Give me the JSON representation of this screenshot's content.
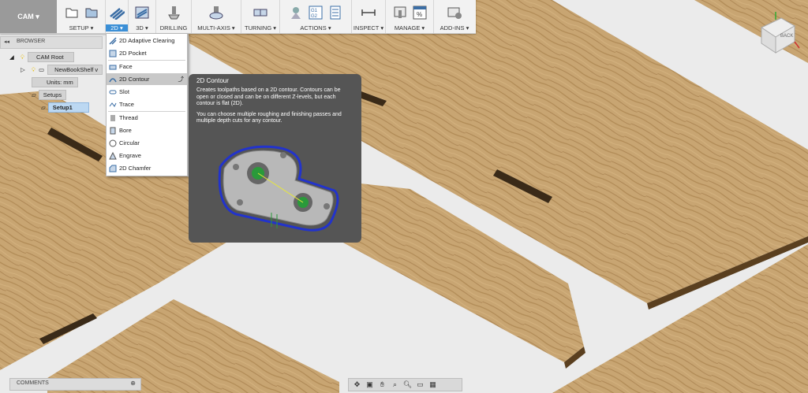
{
  "toolbar": {
    "workspace": "CAM",
    "groups": [
      {
        "label": "SETUP"
      },
      {
        "label": "2D"
      },
      {
        "label": "3D"
      },
      {
        "label": "DRILLING"
      },
      {
        "label": "MULTI-AXIS"
      },
      {
        "label": "TURNING"
      },
      {
        "label": "ACTIONS"
      },
      {
        "label": "INSPECT"
      },
      {
        "label": "MANAGE"
      },
      {
        "label": "ADD-INS"
      }
    ],
    "accent": "#3b8fd6"
  },
  "browser": {
    "title": "BROWSER",
    "root": "CAM Root",
    "model": "NewBookShelf v",
    "units_label": "Units:",
    "units_value": "mm",
    "setups": "Setups",
    "setup1": "Setup1"
  },
  "menu": {
    "items": [
      {
        "label": "2D Adaptive Clearing",
        "icon": "adaptive-clearing-icon"
      },
      {
        "label": "2D Pocket",
        "icon": "pocket-icon"
      },
      {
        "label": "Face",
        "icon": "face-icon"
      },
      {
        "label": "2D Contour",
        "icon": "contour-icon",
        "highlighted": true
      },
      {
        "label": "Slot",
        "icon": "slot-icon"
      },
      {
        "label": "Trace",
        "icon": "trace-icon"
      },
      {
        "label": "Thread",
        "icon": "thread-icon"
      },
      {
        "label": "Bore",
        "icon": "bore-icon"
      },
      {
        "label": "Circular",
        "icon": "circular-icon"
      },
      {
        "label": "Engrave",
        "icon": "engrave-icon"
      },
      {
        "label": "2D Chamfer",
        "icon": "chamfer-icon"
      }
    ]
  },
  "tooltip": {
    "title": "2D Contour",
    "p1": "Creates toolpaths based on a 2D contour. Contours can be open or closed and can be on different Z-levels, but each contour is flat (2D).",
    "p2": "You can choose multiple roughing and finishing passes and multiple depth cuts for any contour."
  },
  "viewcube": {
    "label": "BACK"
  },
  "comments": {
    "label": "COMMENTS"
  }
}
